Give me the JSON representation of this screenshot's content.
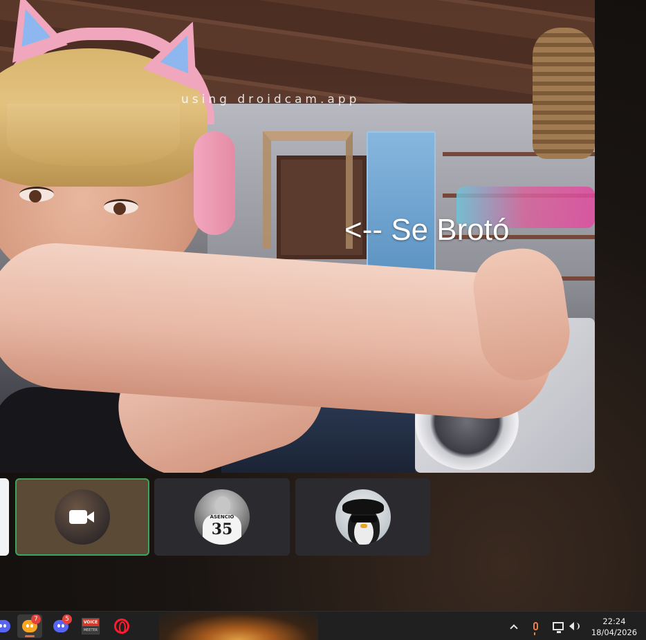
{
  "stream": {
    "watermark": "using droidcam.app",
    "overlay_caption": "<-- Se Brotó"
  },
  "participants": [
    {
      "id": "self",
      "video_off_icon": "camera-icon",
      "selected": true
    },
    {
      "id": "participant-2",
      "jersey_name": "ASENCIO",
      "jersey_number": "35"
    },
    {
      "id": "participant-3",
      "avatar": "penguin-with-sunglasses"
    }
  ],
  "taskbar": {
    "apps": [
      {
        "name": "discord",
        "icon": "discord-icon"
      },
      {
        "name": "discord-ptb",
        "icon": "discord-ptb-icon",
        "badge": "7",
        "active": true
      },
      {
        "name": "discord-2",
        "icon": "discord-icon",
        "badge": "5"
      },
      {
        "name": "voicemeeter",
        "icon": "voicemeeter-icon",
        "label_top": "VOICE",
        "label_bottom": "MEETER"
      },
      {
        "name": "opera-gx",
        "icon": "opera-icon"
      }
    ],
    "tray": {
      "icons": [
        "chevron-up-icon",
        "microphone-icon",
        "network-icon",
        "volume-icon"
      ],
      "time": "22:24",
      "date": "18/04/2026"
    }
  },
  "colors": {
    "selected_border": "#3ba55c",
    "badge": "#e3413c",
    "taskbar": "#202020"
  }
}
